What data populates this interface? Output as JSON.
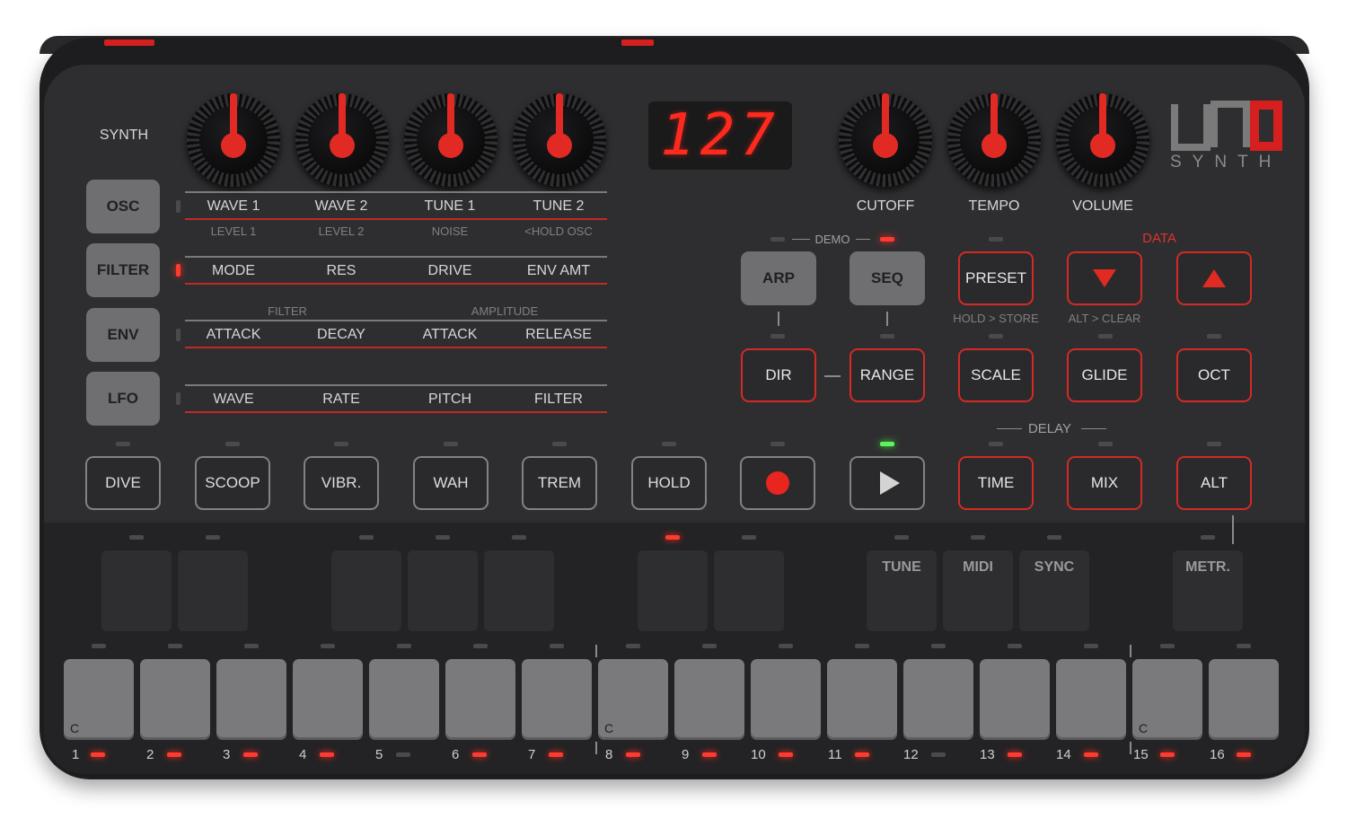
{
  "synth_label": "SYNTH",
  "display_value": "127",
  "logo": {
    "subtitle": "SYNTH"
  },
  "colors": {
    "accent": "#e12a24",
    "led_green": "#5ef25e",
    "body": "#2e2e30"
  },
  "left_knobs": [
    "WAVE 1",
    "WAVE 2",
    "TUNE 1",
    "TUNE 2"
  ],
  "right_knobs": [
    "CUTOFF",
    "TEMPO",
    "VOLUME"
  ],
  "sections": {
    "osc": {
      "button": "OSC",
      "params": [
        "WAVE 1",
        "WAVE 2",
        "TUNE 1",
        "TUNE 2"
      ],
      "alt": [
        "LEVEL 1",
        "LEVEL 2",
        "NOISE",
        "<HOLD OSC"
      ]
    },
    "filter": {
      "button": "FILTER",
      "params": [
        "MODE",
        "RES",
        "DRIVE",
        "ENV AMT"
      ]
    },
    "env": {
      "button": "ENV",
      "group_filter": "FILTER",
      "group_amplitude": "AMPLITUDE",
      "params": [
        "ATTACK",
        "DECAY",
        "ATTACK",
        "RELEASE"
      ]
    },
    "lfo": {
      "button": "LFO",
      "params": [
        "WAVE",
        "RATE",
        "PITCH",
        "FILTER"
      ]
    }
  },
  "demo_label": "DEMO",
  "data_label": "DATA",
  "delay_label": "DELAY",
  "buttons": {
    "arp": "ARP",
    "seq": "SEQ",
    "preset": "PRESET",
    "dir": "DIR",
    "range": "RANGE",
    "scale": "SCALE",
    "glide": "GLIDE",
    "oct": "OCT",
    "time": "TIME",
    "mix": "MIX",
    "alt": "ALT"
  },
  "hints": {
    "preset": "HOLD > STORE",
    "down": "ALT > CLEAR"
  },
  "fx_buttons": [
    "DIVE",
    "SCOOP",
    "VIBR.",
    "WAH",
    "TREM",
    "HOLD"
  ],
  "func_pads": [
    "TUNE",
    "MIDI",
    "SYNC",
    "METR."
  ],
  "key_c_label": "C",
  "key_numbers": [
    "1",
    "2",
    "3",
    "4",
    "5",
    "6",
    "7",
    "8",
    "9",
    "10",
    "11",
    "12",
    "13",
    "14",
    "15",
    "16"
  ]
}
